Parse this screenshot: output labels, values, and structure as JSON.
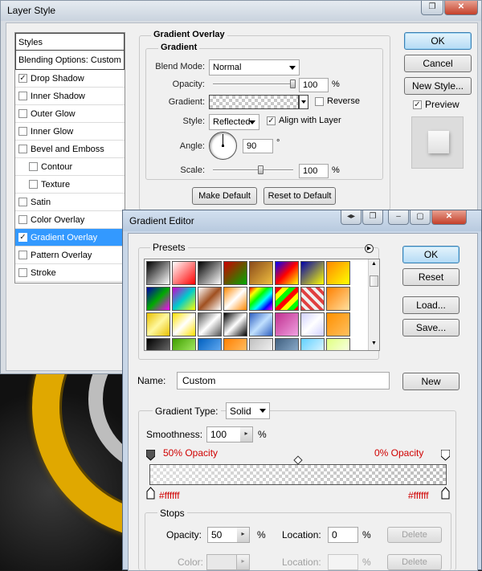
{
  "layer_style": {
    "title": "Layer Style",
    "list_header": "Styles",
    "blending_options": "Blending Options: Custom",
    "items": [
      {
        "label": "Drop Shadow",
        "checked": true,
        "indent": false,
        "selected": false
      },
      {
        "label": "Inner Shadow",
        "checked": false,
        "indent": false,
        "selected": false
      },
      {
        "label": "Outer Glow",
        "checked": false,
        "indent": false,
        "selected": false
      },
      {
        "label": "Inner Glow",
        "checked": false,
        "indent": false,
        "selected": false
      },
      {
        "label": "Bevel and Emboss",
        "checked": false,
        "indent": false,
        "selected": false
      },
      {
        "label": "Contour",
        "checked": false,
        "indent": true,
        "selected": false
      },
      {
        "label": "Texture",
        "checked": false,
        "indent": true,
        "selected": false
      },
      {
        "label": "Satin",
        "checked": false,
        "indent": false,
        "selected": false
      },
      {
        "label": "Color Overlay",
        "checked": false,
        "indent": false,
        "selected": false
      },
      {
        "label": "Gradient Overlay",
        "checked": true,
        "indent": false,
        "selected": true
      },
      {
        "label": "Pattern Overlay",
        "checked": false,
        "indent": false,
        "selected": false
      },
      {
        "label": "Stroke",
        "checked": false,
        "indent": false,
        "selected": false
      }
    ],
    "section_title": "Gradient Overlay",
    "subsection_title": "Gradient",
    "blend_mode_label": "Blend Mode:",
    "blend_mode_value": "Normal",
    "opacity_label": "Opacity:",
    "opacity_value": "100",
    "opacity_unit": "%",
    "opacity_level": 1.0,
    "gradient_label": "Gradient:",
    "reverse_label": "Reverse",
    "reverse_checked": false,
    "style_label": "Style:",
    "style_value": "Reflected",
    "align_label": "Align with Layer",
    "align_checked": true,
    "angle_label": "Angle:",
    "angle_value": "90",
    "angle_unit": "°",
    "scale_label": "Scale:",
    "scale_value": "100",
    "scale_unit": "%",
    "scale_level": 0.6,
    "make_default": "Make Default",
    "reset_default": "Reset to Default",
    "ok": "OK",
    "cancel": "Cancel",
    "new_style": "New Style...",
    "preview_label": "Preview",
    "preview_checked": true
  },
  "gradient_editor": {
    "title": "Gradient Editor",
    "presets_label": "Presets",
    "ok": "OK",
    "reset": "Reset",
    "load": "Load...",
    "save": "Save...",
    "name_label": "Name:",
    "name_value": "Custom",
    "new_button": "New",
    "gradient_type_label": "Gradient Type:",
    "gradient_type_value": "Solid",
    "smoothness_label": "Smoothness:",
    "smoothness_value": "100",
    "smoothness_unit": "%",
    "left_opacity_text": "50% Opacity",
    "right_opacity_text": "0% Opacity",
    "left_color_text": "#ffffff",
    "right_color_text": "#ffffff",
    "stops_label": "Stops",
    "stop_opacity_label": "Opacity:",
    "stop_opacity_value": "50",
    "stop_opacity_unit": "%",
    "stop_location_label": "Location:",
    "stop_location_value": "0",
    "stop_location_unit": "%",
    "delete_label": "Delete",
    "color_label": "Color:",
    "color_location_label": "Location:",
    "color_location_unit": "%",
    "delete2_label": "Delete",
    "preset_swatches": [
      "linear-gradient(135deg,#000,#fff)",
      "linear-gradient(135deg,#fff 0%,#f00 100%)",
      "linear-gradient(135deg,#000,#fff)",
      "linear-gradient(135deg,#c00,#0a0)",
      "linear-gradient(135deg,#8b4a1a,#f0c040)",
      "linear-gradient(135deg,#00f,#f00,#ff0)",
      "linear-gradient(135deg,#00a,#ff0)",
      "linear-gradient(135deg,#f80,#ff0)",
      "linear-gradient(135deg,#00a,#0a0,#f0f)",
      "linear-gradient(135deg,#c0c,#0cc,#ff0)",
      "linear-gradient(135deg,#fff,#a05020,#fff)",
      "linear-gradient(135deg,#f80,#fff,#f80)",
      "linear-gradient(135deg,#f00,#ff0,#0f0,#0ff,#00f,#f0f)",
      "repeating-linear-gradient(135deg,#f00 0 6px,#ff0 6px 12px,#0f0 12px 18px)",
      "repeating-linear-gradient(45deg,#e04040 0 4px,#f0f0f0 4px 8px)",
      "linear-gradient(135deg,#ff8000,#ffe0a0)",
      "linear-gradient(135deg,#e8c000,#fff8a0,#e8c000)",
      "linear-gradient(135deg,#ffe000,#fff,#ffe000)",
      "linear-gradient(135deg,#555,#fff,#555)",
      "linear-gradient(135deg,#000,#fff,#000)",
      "linear-gradient(135deg,#3060c0,#c0e0ff,#3060c0)",
      "linear-gradient(135deg,#c03090,#f0a0e0)",
      "linear-gradient(135deg,#d0d0ff,#fff,#d0d0ff)",
      "linear-gradient(135deg,#ff9000,#ffc060)",
      "linear-gradient(135deg,#000,#888)",
      "linear-gradient(135deg,#40a000,#c0ff80)",
      "linear-gradient(135deg,#0060c0,#80c0ff)",
      "linear-gradient(135deg,#ff8000,#ffd080)",
      "linear-gradient(135deg,#c0c0c0,#fff)",
      "linear-gradient(135deg,#406080,#a0c0e0)",
      "linear-gradient(135deg,#60d0ff,#fff)",
      "linear-gradient(135deg,#e0ff80,#fff)"
    ]
  }
}
